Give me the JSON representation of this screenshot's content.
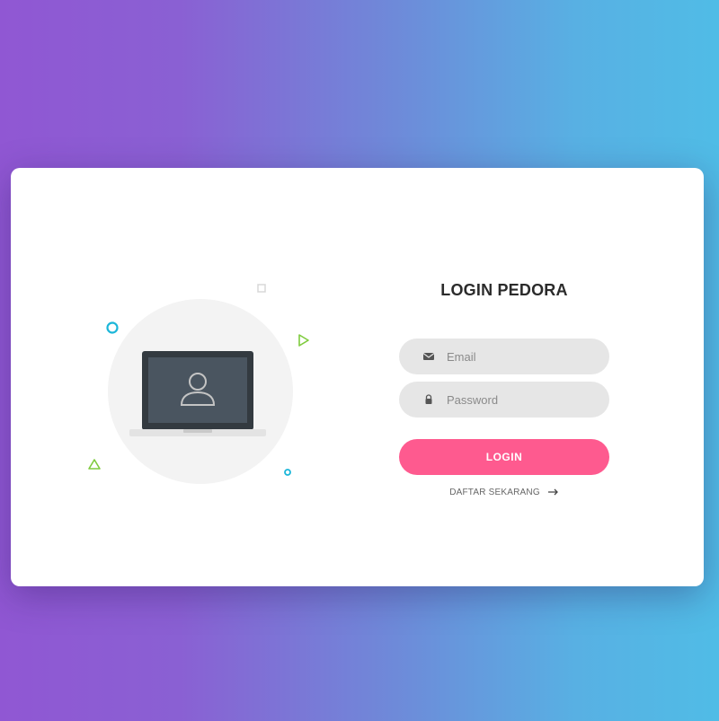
{
  "colors": {
    "gradient_start": "#9057d3",
    "gradient_end": "#50bce6",
    "card_bg": "#ffffff",
    "input_bg": "#e6e6e6",
    "button_bg": "#fe5a8f",
    "title_color": "#2b2b2b",
    "deco_cyan": "#1bb6d9",
    "deco_green": "#7fcb3e"
  },
  "illustration": {
    "icons": [
      "laptop-icon",
      "user-icon",
      "circle-deco-icon",
      "square-deco-icon",
      "triangle-deco-icon",
      "play-deco-icon",
      "ring-deco-icon"
    ]
  },
  "form": {
    "title": "LOGIN PEDORA",
    "email": {
      "placeholder": "Email",
      "value": "",
      "icon": "envelope-icon"
    },
    "password": {
      "placeholder": "Password",
      "value": "",
      "icon": "lock-icon"
    },
    "login_label": "LOGIN",
    "signup_label": "DAFTAR SEKARANG",
    "signup_icon": "arrow-right-icon"
  }
}
